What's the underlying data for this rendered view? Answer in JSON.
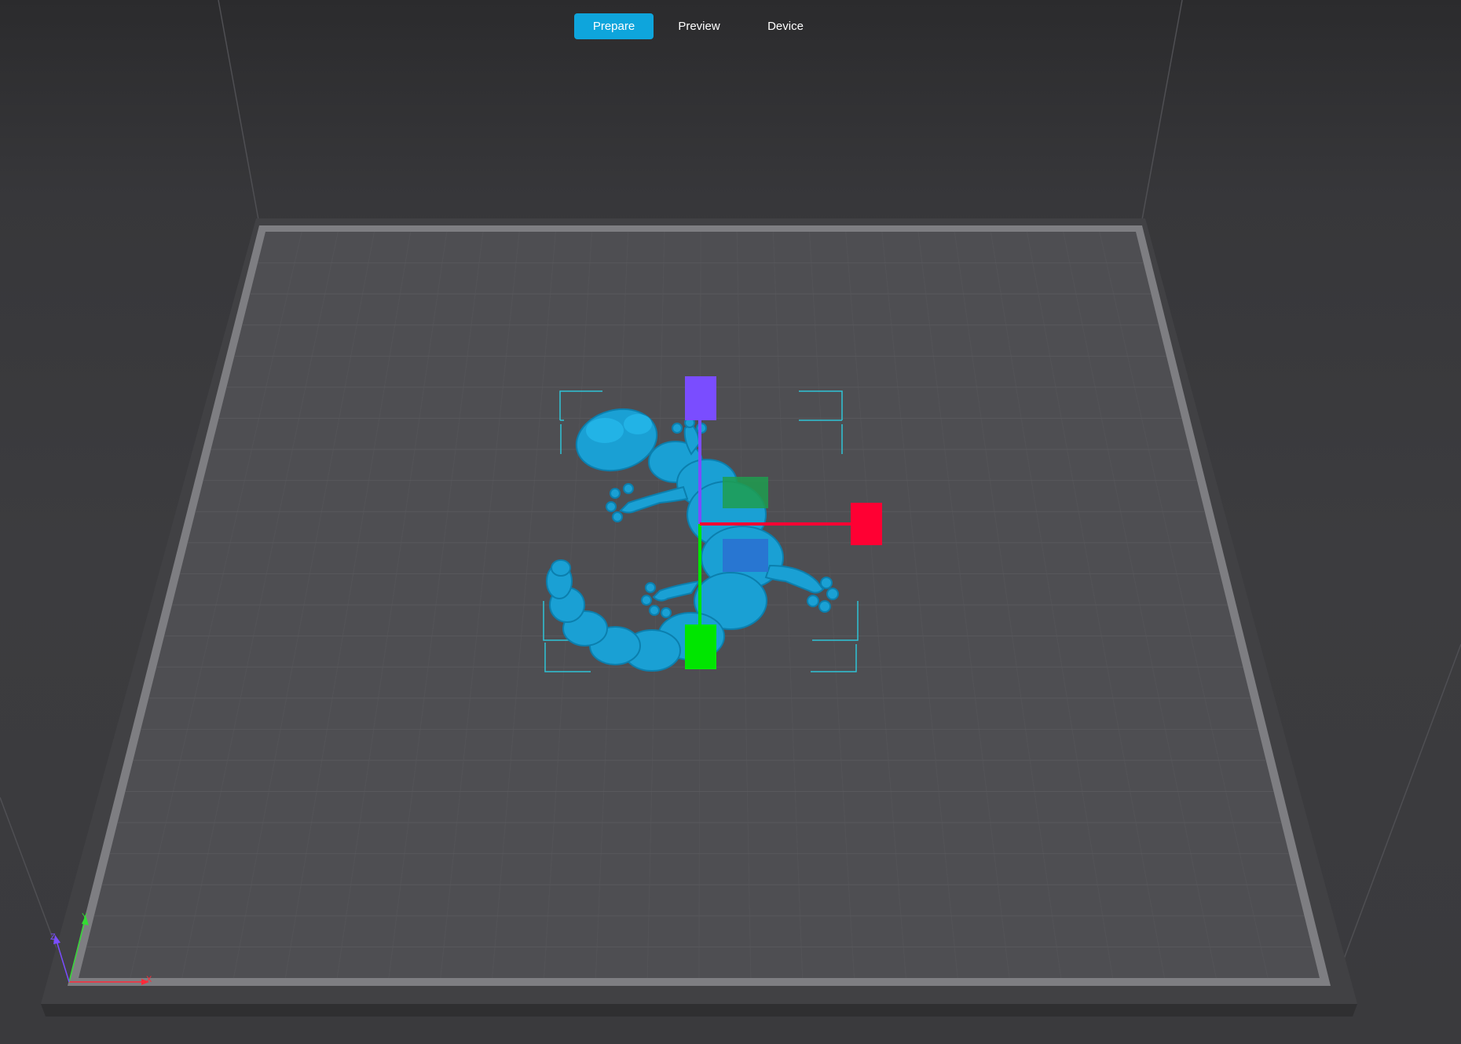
{
  "tabs": [
    {
      "label": "Prepare",
      "active": true
    },
    {
      "label": "Preview",
      "active": false
    },
    {
      "label": "Device",
      "active": false
    }
  ],
  "axes": {
    "x_label": "X",
    "y_label": "Y",
    "z_label": "Z"
  },
  "colors": {
    "accent": "#0ea5dc",
    "model": "#1aa0d4",
    "gizmo_x": "#ff0033",
    "gizmo_y": "#00e600",
    "gizmo_z": "#7a4dff",
    "bed": "#4e4e52",
    "bed_frame": "#8a8a8d"
  },
  "icons": {
    "view_axis": "xyz-axis-icon",
    "move_gizmo": "move-gizmo-icon"
  }
}
